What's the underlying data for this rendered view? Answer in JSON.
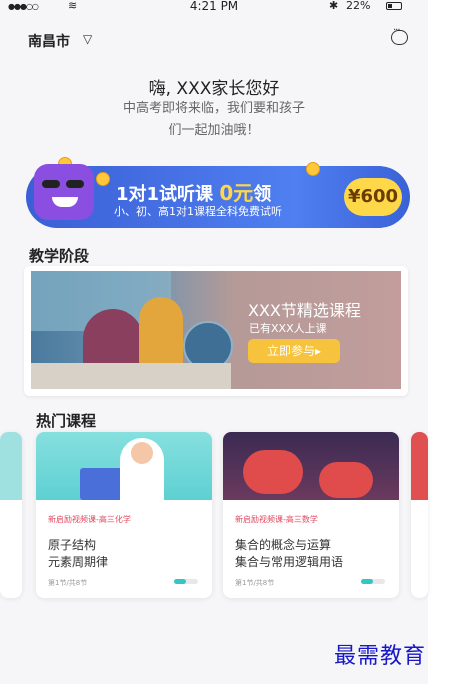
{
  "status_bar": {
    "signal": "●●●○○",
    "time": "4:21 PM",
    "battery": "22%"
  },
  "header": {
    "city": "南昌市"
  },
  "greeting": {
    "title": "嗨, XXX家长您好",
    "line1": "中高考即将来临，我们要和孩子",
    "line2": "们一起加油哦！"
  },
  "banner": {
    "title_prefix": "1对1试听课",
    "title_highlight": "0元",
    "title_suffix": "领",
    "subtitle": "小、初、高1对1课程全科免费试听",
    "price": "¥600"
  },
  "sections": {
    "stage": "教学阶段",
    "hot": "热门课程"
  },
  "stage_card": {
    "title": "XXX节精选课程",
    "subtitle": "已有XXX人上课",
    "button": "立即参与▸"
  },
  "courses": [
    {
      "tag": "新启励视频课-高三化学",
      "title1": "原子结构",
      "title2": "元素周期律",
      "progress": "第1节/共8节",
      "progress_fraction": 0.5
    },
    {
      "tag": "新启励视频课-高三数学",
      "title1": "集合的概念与运算",
      "title2": "集合与常用逻辑用语",
      "progress": "第1节/共8节",
      "progress_fraction": 0.5
    }
  ],
  "watermark": "最需教育",
  "colors": {
    "banner_blue": "#3f6ae0",
    "price_yellow": "#ffd84a",
    "tag_red": "#e0465c",
    "progress_teal": "#34c7c2",
    "button_yellow": "#f7c23c"
  }
}
